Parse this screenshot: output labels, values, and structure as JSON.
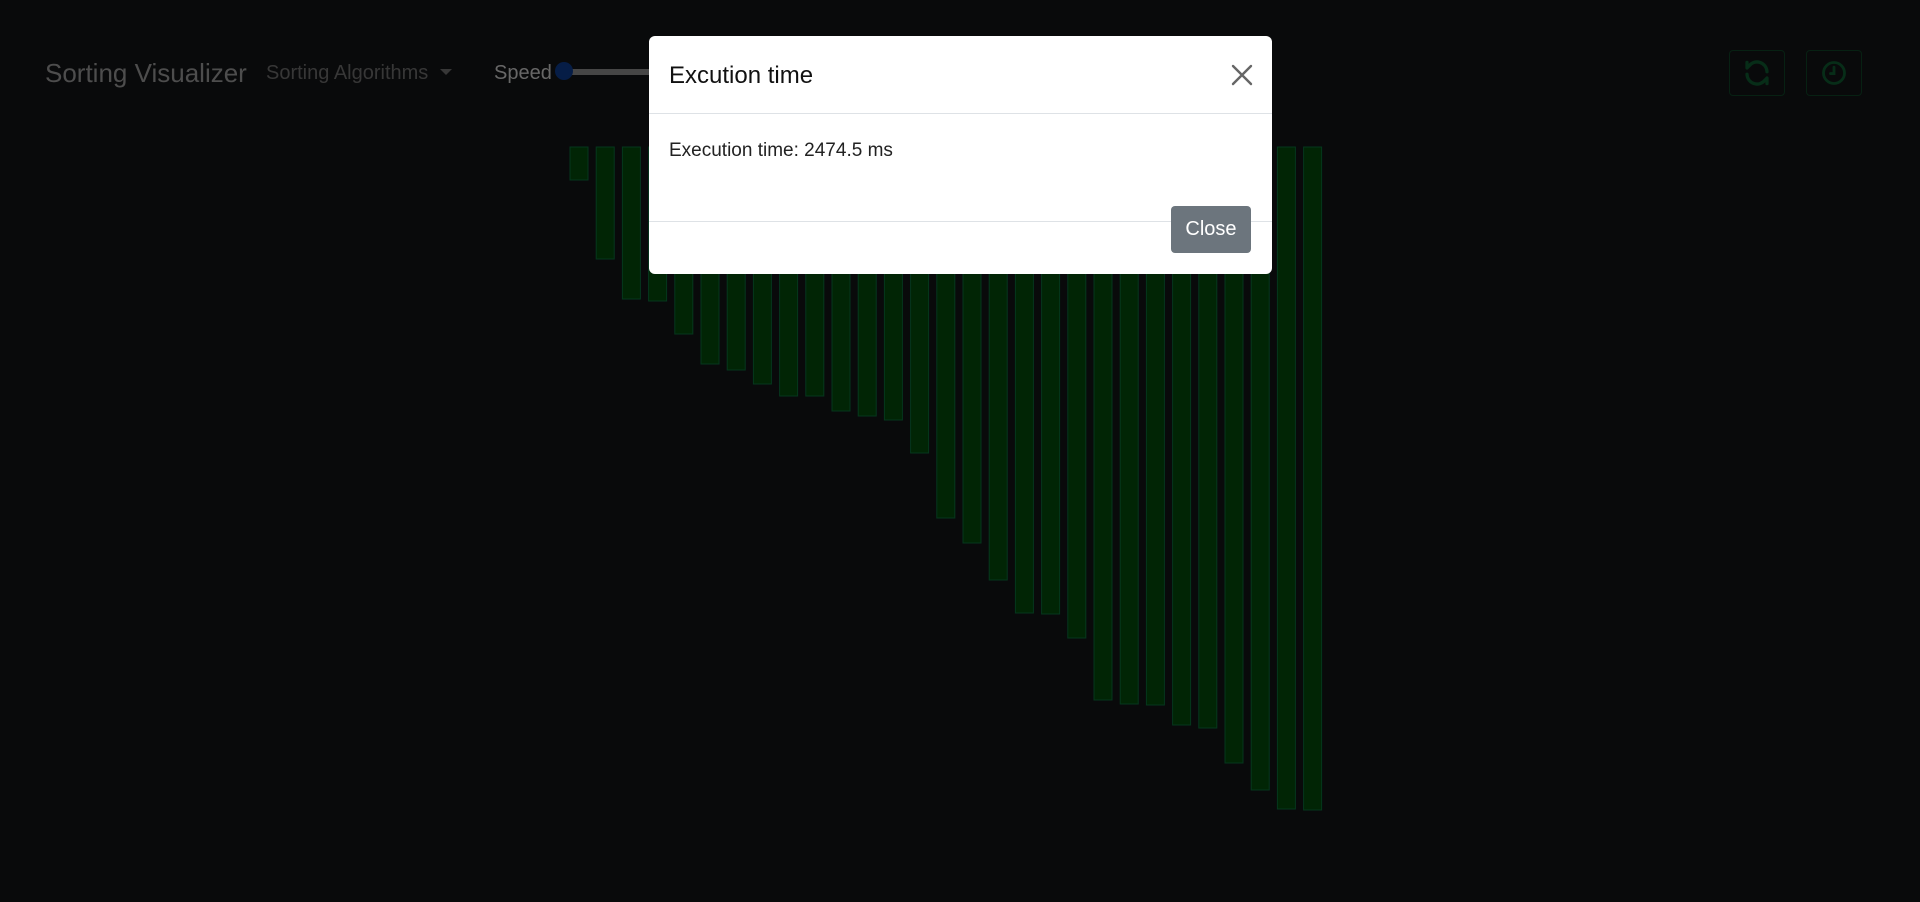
{
  "navbar": {
    "brand": "Sorting Visualizer",
    "algorithms_dropdown": "Sorting Algorithms",
    "speed_label": "Speed",
    "speed_value": 0.0
  },
  "icons": {
    "refresh": "refresh-icon",
    "clock": "clock-icon"
  },
  "colors": {
    "background": "#131416",
    "bar_fill": "#024a0b",
    "bar_border": "#0b6e3a",
    "accent_green": "#0e5a30",
    "slider_thumb": "#0d3b8c",
    "close_button": "#6c757d"
  },
  "modal": {
    "title": "Excution time",
    "message": "Execution time: 2474.5 ms",
    "close_label": "Close"
  },
  "chart_data": {
    "type": "bar",
    "values": [
      33,
      112,
      152,
      154,
      187,
      217,
      223,
      237,
      249,
      249,
      264,
      269,
      273,
      306,
      371,
      396,
      433,
      466,
      467,
      491,
      553,
      557,
      558,
      578,
      581,
      616,
      643,
      662,
      663
    ]
  }
}
